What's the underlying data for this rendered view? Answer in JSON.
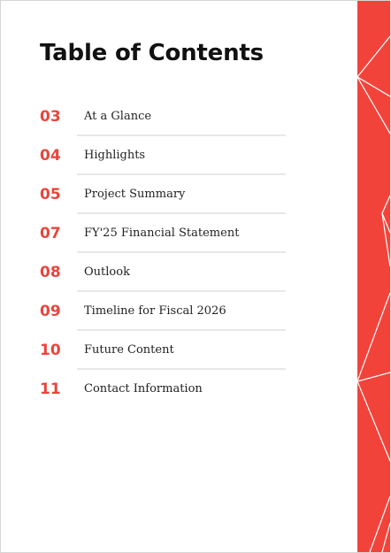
{
  "page": {
    "title": "Table of Contents"
  },
  "toc": {
    "items": [
      {
        "number": "03",
        "label": "At a Glance"
      },
      {
        "number": "04",
        "label": "Highlights"
      },
      {
        "number": "05",
        "label": "Project Summary"
      },
      {
        "number": "07",
        "label": "FY'25 Financial Statement"
      },
      {
        "number": "08",
        "label": "Outlook"
      },
      {
        "number": "09",
        "label": "Timeline for Fiscal 2026"
      },
      {
        "number": "10",
        "label": "Future Content"
      },
      {
        "number": "11",
        "label": "Contact Information"
      }
    ]
  },
  "colors": {
    "accent": "#e8453c",
    "band": "#f2433b",
    "divider": "#e8e8e8",
    "text": "#222222"
  },
  "decoration": {
    "side_band_icon": "low-poly-line-pattern"
  }
}
